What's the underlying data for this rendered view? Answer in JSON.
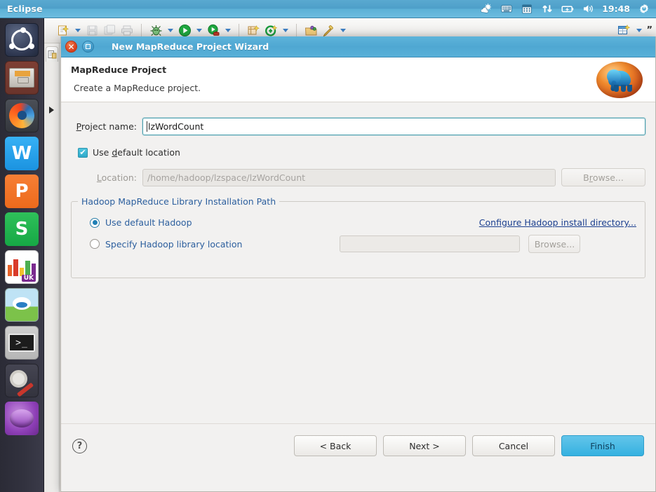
{
  "top_panel": {
    "app_name": "Eclipse",
    "clock": "19:48",
    "tray_icons": [
      "weather-icon",
      "keyboard-icon",
      "calendar-icon",
      "network-transfer-icon",
      "battery-icon",
      "volume-icon",
      "power-gear-icon"
    ]
  },
  "launcher": {
    "items": [
      {
        "name": "ubuntu-dash",
        "label": "Ubuntu Dash"
      },
      {
        "name": "files",
        "label": "Files"
      },
      {
        "name": "firefox",
        "label": "Firefox"
      },
      {
        "name": "wps-writer",
        "label": "W"
      },
      {
        "name": "wps-presentation",
        "label": "P"
      },
      {
        "name": "wps-spreadsheet",
        "label": "S"
      },
      {
        "name": "ubuntu-software",
        "label": "UK"
      },
      {
        "name": "amazon",
        "label": "Amazon"
      },
      {
        "name": "terminal",
        "label": ">_"
      },
      {
        "name": "system-tools",
        "label": "System Tools"
      },
      {
        "name": "eclipse",
        "label": "Eclipse"
      }
    ]
  },
  "eclipse_toolbar": {
    "icons": [
      "new-wizard-icon",
      "new-dropdown-arrow",
      "save-icon",
      "save-all-icon",
      "print-icon",
      "debug-icon",
      "debug-dropdown-arrow",
      "run-icon",
      "run-dropdown-arrow",
      "run-external-icon",
      "run-external-dropdown-arrow",
      "new-java-class-icon",
      "new-annotation-icon",
      "new-annotation-dropdown-arrow",
      "open-type-icon",
      "search-icon",
      "search-dropdown-arrow",
      "new-table-icon",
      "toolbar-dropdown-arrow"
    ],
    "overflow_label": "”"
  },
  "dialog": {
    "title": "New MapReduce Project Wizard",
    "close_label": "✕",
    "header": {
      "title": "MapReduce Project",
      "subtitle": "Create a MapReduce project."
    },
    "project_name": {
      "label": "Project name:",
      "label_mnemonic": "P",
      "label_rest": "roject name:",
      "value": "lzWordCount"
    },
    "use_default_location": {
      "label_before": "Use ",
      "label_mnemonic": "d",
      "label_after": "efault location",
      "checked": true,
      "tick": "✔"
    },
    "location": {
      "label_mnemonic": "L",
      "label_rest": "ocation:",
      "value": "/home/hadoop/lzspace/lzWordCount",
      "browse_label_before": "B",
      "browse_label_mnemonic": "r",
      "browse_label_after": "owse...",
      "enabled": false
    },
    "hadoop_group": {
      "legend": "Hadoop MapReduce Library Installation Path",
      "option_default": "Use default Hadoop",
      "option_specify": "Specify Hadoop library location",
      "selected": "default",
      "configure_link": "Configure Hadoop install directory...",
      "specify_value": "",
      "browse_label": "Browse..."
    },
    "footer": {
      "help_label": "?",
      "back": "< Back",
      "next": "Next >",
      "cancel": "Cancel",
      "finish": "Finish"
    }
  },
  "colors": {
    "panel_blue": "#4fa7d2",
    "accent_finish": "#35b1e0",
    "link_blue": "#1b3f8f",
    "group_legend_blue": "#2c5f9e",
    "close_red": "#d8401d",
    "focus_teal": "#4a9fae"
  }
}
